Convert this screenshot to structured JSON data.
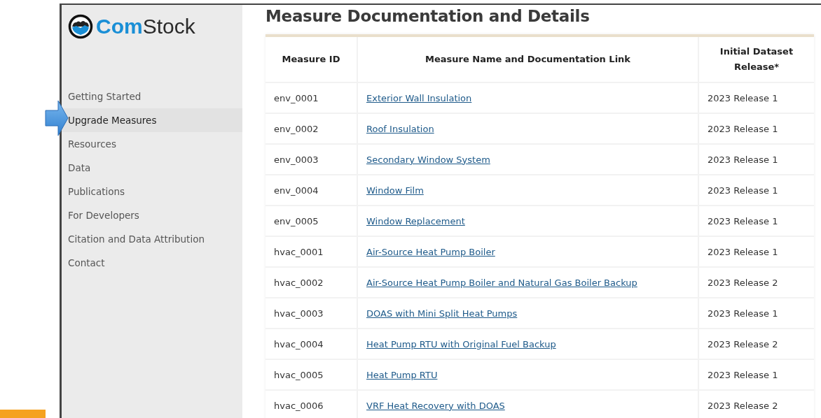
{
  "sidebar": {
    "logo": {
      "bold": "Com",
      "rest": "Stock"
    },
    "items": [
      {
        "label": "Getting Started",
        "selected": false
      },
      {
        "label": "Upgrade Measures",
        "selected": true
      },
      {
        "label": "Resources",
        "selected": false
      },
      {
        "label": "Data",
        "selected": false
      },
      {
        "label": "Publications",
        "selected": false
      },
      {
        "label": "For Developers",
        "selected": false
      },
      {
        "label": "Citation and Data Attribution",
        "selected": false
      },
      {
        "label": "Contact",
        "selected": false
      }
    ]
  },
  "page_title": "Measure Documentation and Details",
  "table": {
    "columns": [
      "Measure ID",
      "Measure Name and Documentation Link",
      "Initial Dataset Release*"
    ],
    "rows": [
      {
        "id": "env_0001",
        "name": "Exterior Wall Insulation",
        "release": "2023 Release 1"
      },
      {
        "id": "env_0002",
        "name": "Roof Insulation",
        "release": "2023 Release 1"
      },
      {
        "id": "env_0003",
        "name": "Secondary Window System",
        "release": "2023 Release 1"
      },
      {
        "id": "env_0004",
        "name": "Window Film",
        "release": "2023 Release 1"
      },
      {
        "id": "env_0005",
        "name": "Window Replacement",
        "release": "2023 Release 1"
      },
      {
        "id": "hvac_0001",
        "name": "Air-Source Heat Pump Boiler",
        "release": "2023 Release 1"
      },
      {
        "id": "hvac_0002",
        "name": "Air-Source Heat Pump Boiler and Natural Gas Boiler Backup",
        "release": "2023 Release 2"
      },
      {
        "id": "hvac_0003",
        "name": "DOAS with Mini Split Heat Pumps",
        "release": "2023 Release 1"
      },
      {
        "id": "hvac_0004",
        "name": "Heat Pump RTU with Original Fuel Backup",
        "release": "2023 Release 2"
      },
      {
        "id": "hvac_0005",
        "name": "Heat Pump RTU",
        "release": "2023 Release 1"
      },
      {
        "id": "hvac_0006",
        "name": "VRF Heat Recovery with DOAS",
        "release": "2023 Release 2"
      }
    ]
  }
}
